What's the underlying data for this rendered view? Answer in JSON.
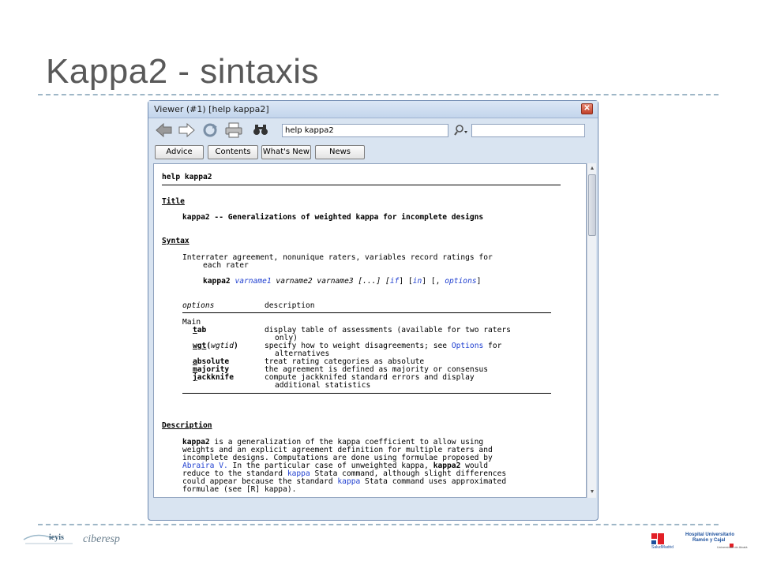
{
  "slide": {
    "title": "Kappa2 - sintaxis"
  },
  "window": {
    "title": "Viewer (#1) [help kappa2]",
    "address": "help kappa2",
    "buttons": [
      "Advice",
      "Contents",
      "What's New",
      "News"
    ]
  },
  "help": {
    "header": "help kappa2",
    "title_heading": "Title",
    "title_text": "kappa2 -- Generalizations of weighted kappa for incomplete designs",
    "syntax_heading": "Syntax",
    "syntax_desc_1": "Interrater agreement, nonunique raters, variables record ratings for",
    "syntax_desc_2": "each rater",
    "syntax_cmd": "kappa2",
    "syntax_vars": "varname1",
    "syntax_rest": " varname2 varname3 [...] [",
    "syntax_if": "if",
    "syntax_mid": "] [",
    "syntax_in": "in",
    "syntax_end1": "] [, ",
    "syntax_options": "options",
    "syntax_end2": "]",
    "opt_col1": "options",
    "opt_col2": "description",
    "opt_group": "Main",
    "options": [
      {
        "name": "tab",
        "desc": "display table of assessments (available for two raters",
        "desc2": "only)"
      },
      {
        "name": "wgt(wgtid)",
        "desc": "specify how to weight disagreements; see ",
        "link": "Options",
        "desc_end": " for",
        "desc2": "alternatives"
      },
      {
        "name": "absolute",
        "desc": "treat rating categories as absolute"
      },
      {
        "name": "majority",
        "desc": "the agreement is defined as majority or consensus"
      },
      {
        "name": "jackknife",
        "desc": "compute jackknifed standard errors and display",
        "desc2": "additional statistics"
      }
    ],
    "description_heading": "Description",
    "description": {
      "cmd": "kappa2",
      "l1": " is a generalization of the kappa coefficient to allow using",
      "l2": "weights and an explicit agreement definition for multiple raters and",
      "l3": "incomplete designs. Computations are done using formulae proposed by",
      "l4_link": "Abraira V.",
      "l4": " In the particular case of unweighted kappa, ",
      "l4_cmd": "kappa2",
      "l4_end": " would",
      "l5a": "reduce to the standard ",
      "l5_link": "kappa",
      "l5b": " Stata command, although slight differences",
      "l6a": "could appear because the standard ",
      "l6_link": "kappa",
      "l6b": " Stata command uses approximated",
      "l7": "formulae (see [R] kappa)."
    }
  },
  "footer": {
    "logo_left_1": "ieyis",
    "logo_left_2": "ciberesp",
    "logo_right_title": "Hospital Universitario",
    "logo_right_sub": "Ramón y Cajal",
    "logo_right_small": "SaludMadrid",
    "logo_right_uni": "Universidad de Alcalá"
  },
  "colors": {
    "title": "#595959",
    "link": "#1f3fd0",
    "dashes": "#9fb7c7"
  }
}
